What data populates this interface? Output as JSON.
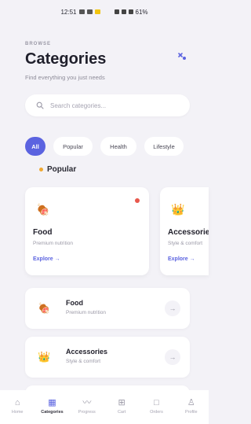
{
  "status_bar": {
    "time": "12:51",
    "right_text": "61%"
  },
  "header": {
    "eyebrow": "BROWSE",
    "title": "Categories",
    "subtitle": "Find everything you just needs"
  },
  "search": {
    "placeholder": "Search categories..."
  },
  "chips": [
    {
      "label": "All",
      "active": true
    },
    {
      "label": "Popular",
      "active": false
    },
    {
      "label": "Health",
      "active": false
    },
    {
      "label": "Lifestyle",
      "active": false
    }
  ],
  "section": {
    "label": "Popular"
  },
  "featured_cards": [
    {
      "title": "Food",
      "subtitle": "Premium nutrition",
      "link": "Explore →",
      "icon": "food-icon"
    },
    {
      "title": "Accessories",
      "subtitle": "Style & comfort",
      "link": "Explore →",
      "icon": "crown-icon"
    }
  ],
  "category_rows": [
    {
      "title": "Food",
      "subtitle": "Premium nutrition",
      "icon": "food-icon"
    },
    {
      "title": "Accessories",
      "subtitle": "Style & comfort",
      "icon": "crown-icon"
    }
  ],
  "tabbar": [
    {
      "label": "Home",
      "icon": "home-icon",
      "active": false
    },
    {
      "label": "Categories",
      "icon": "grid-icon",
      "active": true
    },
    {
      "label": "Progress",
      "icon": "chart-icon",
      "active": false
    },
    {
      "label": "Cart",
      "icon": "cart-icon",
      "active": false
    },
    {
      "label": "Orders",
      "icon": "bag-icon",
      "active": false
    },
    {
      "label": "Profile",
      "icon": "user-icon",
      "active": false
    }
  ],
  "colors": {
    "accent": "#5b63e0",
    "background": "#f3f2f7"
  }
}
